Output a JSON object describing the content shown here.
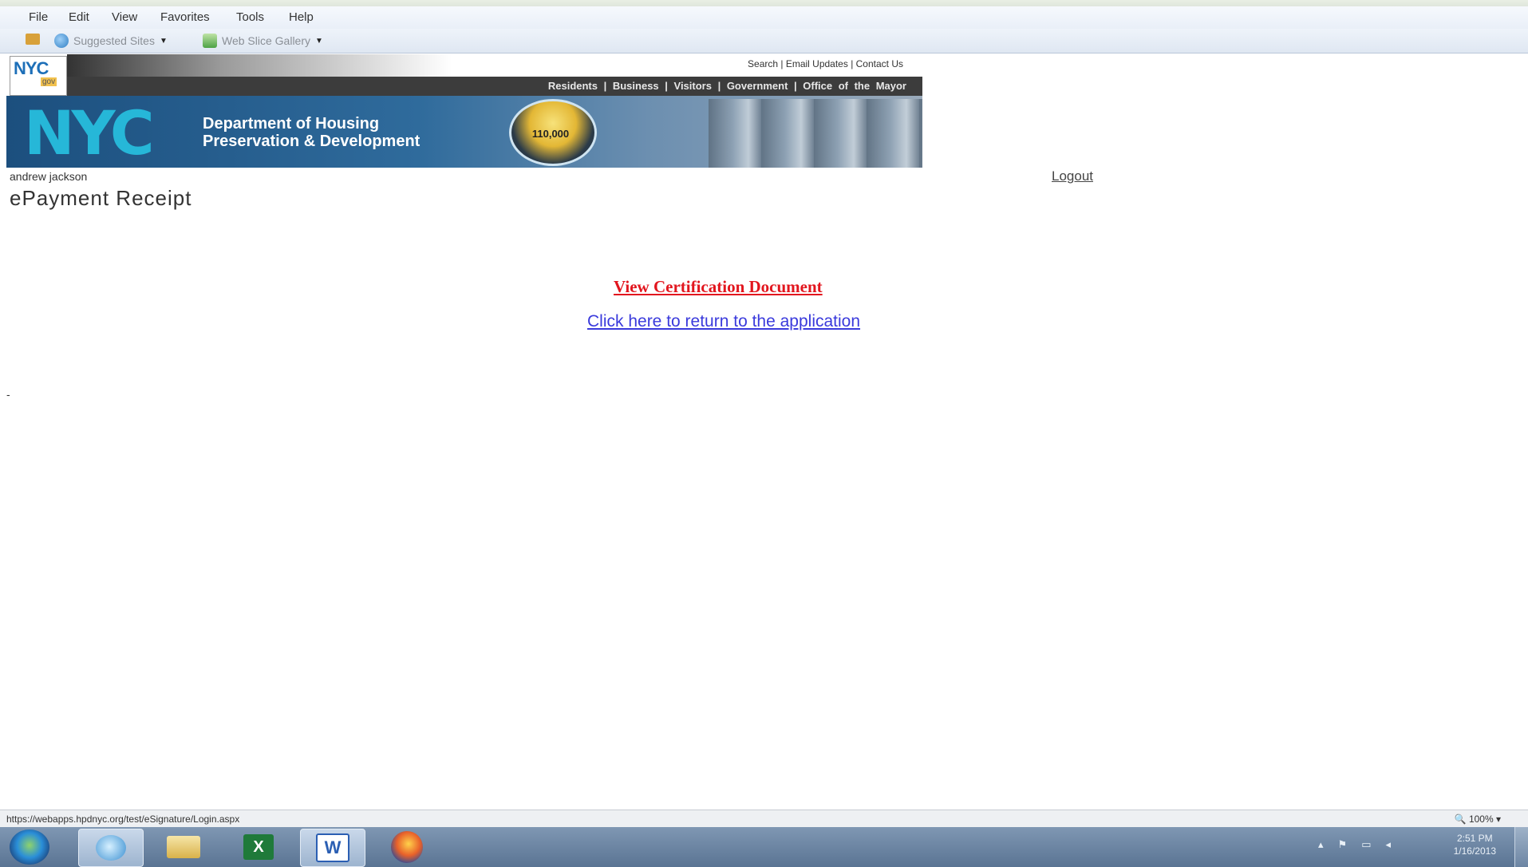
{
  "browser": {
    "menu": [
      "File",
      "Edit",
      "View",
      "Favorites",
      "Tools",
      "Help"
    ],
    "favorites": {
      "suggested": "Suggested Sites",
      "webslice": "Web Slice Gallery"
    },
    "status_url": "https://webapps.hpdnyc.org/test/eSignature/Login.aspx",
    "zoom": "100%"
  },
  "header": {
    "logo_text": "NYC",
    "logo_sub": "gov",
    "top_links": "Search | Email Updates | Contact Us",
    "nav": "Residents | Business | Visitors | Government | Office of the Mayor",
    "nyc_big": "NYC",
    "dept_line1": "Department of Housing",
    "dept_line2": "Preservation & Development",
    "badge": "110,000"
  },
  "page": {
    "user": "andrew jackson",
    "logout": "Logout",
    "title": "ePayment Receipt",
    "view_cert": "View Certification Document",
    "return_link": "Click here to return to the application",
    "dash": "-"
  },
  "taskbar": {
    "word_letter": "W",
    "excel_letter": "X",
    "clock_time": "2:51 PM",
    "clock_date": "1/16/2013"
  }
}
